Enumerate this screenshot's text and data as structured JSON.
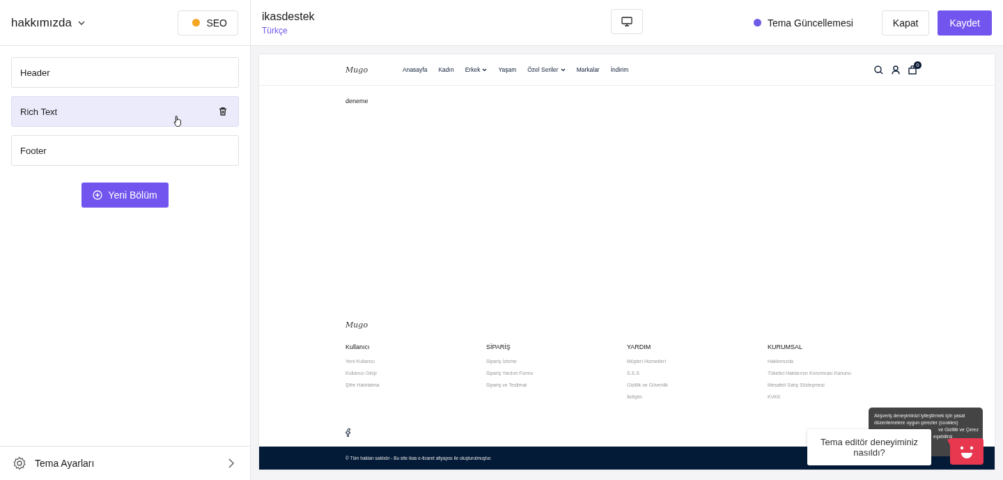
{
  "page_selector": {
    "label": "hakkımızda"
  },
  "seo_button": {
    "label": "SEO",
    "color": "#f5a623"
  },
  "store": {
    "name": "ikasdestek",
    "language": "Türkçe"
  },
  "theme_update": {
    "label": "Tema Güncellemesi",
    "color": "#6c5ce7"
  },
  "buttons": [
    {
      "label": "Kapat",
      "kind": "secondary"
    },
    {
      "label": "Kaydet",
      "kind": "primary"
    }
  ],
  "sections": [
    {
      "label": "Header",
      "selected": false
    },
    {
      "label": "Rich Text",
      "selected": true
    },
    {
      "label": "Footer",
      "selected": false
    }
  ],
  "add_section": {
    "label": "Yeni Bölüm"
  },
  "theme_settings": {
    "label": "Tema Ayarları"
  },
  "preview": {
    "logo": "Mugo",
    "nav": [
      {
        "label": "Anasayfa",
        "dropdown": false
      },
      {
        "label": "Kadın",
        "dropdown": false
      },
      {
        "label": "Erkek",
        "dropdown": true
      },
      {
        "label": "Yaşam",
        "dropdown": false
      },
      {
        "label": "Özel Seriler",
        "dropdown": true
      },
      {
        "label": "Markalar",
        "dropdown": false
      },
      {
        "label": "İndirim",
        "dropdown": false
      }
    ],
    "cart_count": "0",
    "content": "deneme",
    "footer_logo": "Mugo",
    "footer_columns": [
      {
        "title": "Kullanıcı",
        "links": [
          "Yeni Kullanıcı",
          "Kullanıcı Girişi",
          "Şifre Hatırlatma"
        ]
      },
      {
        "title": "SİPARİŞ",
        "links": [
          "Sipariş İzleme",
          "Sipariş Yardım Formu",
          "Sipariş ve Teslimat"
        ]
      },
      {
        "title": "YARDIM",
        "links": [
          "Müşteri Hizmetleri",
          "S.S.S",
          "Gizlilik ve Güvenlik",
          "İletişim"
        ]
      },
      {
        "title": "KURUMSAL",
        "links": [
          "Hakkımızda",
          "Tüketici Haklarının Korunması Kanunu",
          "Mesafeli Satış Sözleşmesi",
          "KVKK"
        ]
      }
    ],
    "copyright": "© Tüm hakları saklıdır - Bu site ikas e-ticaret altyapısı ile oluşturulmuştur.",
    "cookie_lines": [
      "Alışveriş deneyiminizi iyileştirmek için yasal",
      "düzenlemelere uygun çerezler (cookies)",
      "ve Gizlilik ve Çerez",
      "eşebilirsi"
    ]
  },
  "feedback": {
    "question": "Tema editör deneyiminiz nasıldı?"
  }
}
